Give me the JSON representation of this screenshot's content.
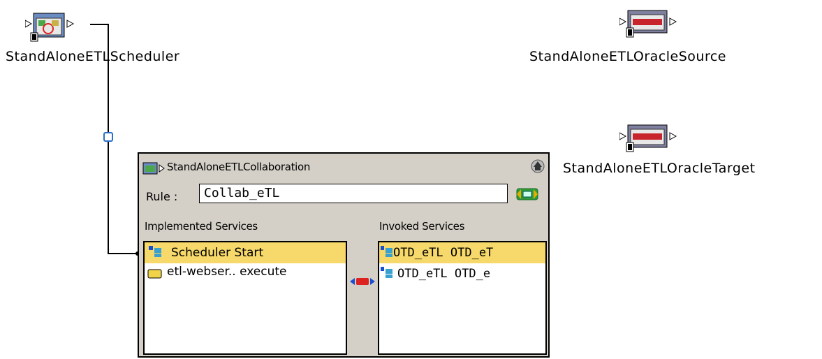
{
  "canvas": {
    "nodes": {
      "scheduler": {
        "label": "StandAloneETLScheduler",
        "icon": "scheduler-service-icon"
      },
      "oracle_source": {
        "label": "StandAloneETLOracleSource",
        "icon": "oracle-service-icon"
      },
      "oracle_target": {
        "label": "StandAloneETLOracleTarget",
        "icon": "oracle-service-icon"
      }
    }
  },
  "collaboration": {
    "title": "StandAloneETLCollaboration",
    "rule_label": "Rule :",
    "rule_value": "Collab_eTL",
    "implemented_label": "Implemented Services",
    "invoked_label": "Invoked Services",
    "implemented_items": [
      {
        "text": "Scheduler Start",
        "icon": "service-icon",
        "selected": true
      },
      {
        "text": "etl-webser.. execute",
        "icon": "folder-icon",
        "selected": false
      }
    ],
    "invoked_items": [
      {
        "text": "OTD_eTL  OTD_eT",
        "icon": "otd-icon",
        "selected": true
      },
      {
        "text": "OTD_eTL  OTD_e",
        "icon": "otd-icon",
        "selected": false
      }
    ],
    "colors": {
      "selection": "#f7d86a",
      "panel": "#d4d0c8"
    }
  }
}
